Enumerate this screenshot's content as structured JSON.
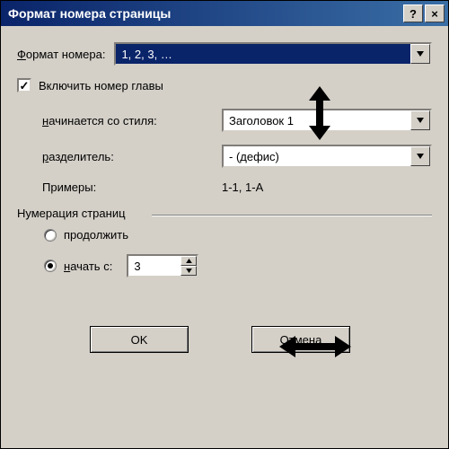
{
  "window": {
    "title": "Формат номера страницы",
    "help_icon": "?",
    "close_icon": "×"
  },
  "format": {
    "label": "Формат номера:",
    "label_ul_char": "Ф",
    "value": "1, 2, 3, …"
  },
  "include_chapter": {
    "label": "Включить номер главы",
    "checked": true
  },
  "starts_with": {
    "label": "начинается со стиля:",
    "label_ul_char": "н",
    "value": "Заголовок 1"
  },
  "separator": {
    "label": "разделитель:",
    "label_ul_char": "р",
    "value": "-    (дефис)"
  },
  "examples": {
    "label": "Примеры:",
    "value": "1-1, 1-A"
  },
  "numbering": {
    "legend": "Нумерация страниц",
    "continue": {
      "label": "продолжить",
      "checked": false
    },
    "start_at": {
      "label": "начать с:",
      "checked": true,
      "value": "3"
    }
  },
  "buttons": {
    "ok": "OK",
    "cancel": "Отмена"
  }
}
